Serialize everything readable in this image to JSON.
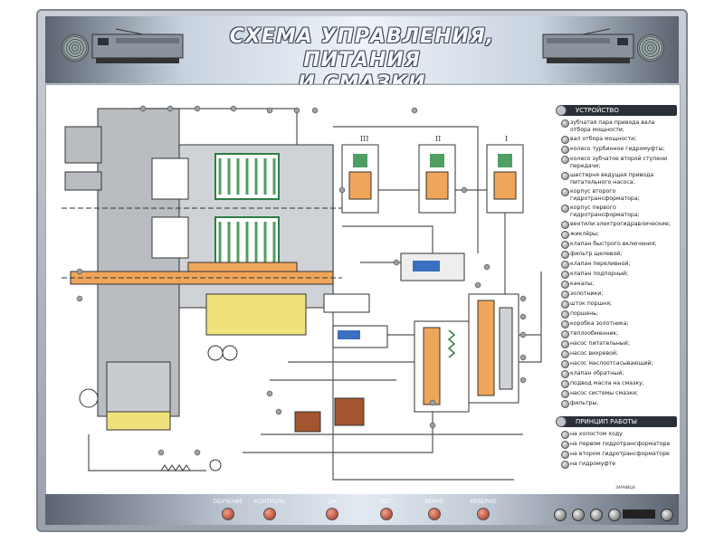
{
  "header": {
    "title_line1": "СХЕМА УПРАВЛЕНИЯ, ПИТАНИЯ",
    "title_line2": "И СМАЗКИ ГИДРОПЕРЕДАЧИ"
  },
  "diagram": {
    "valve_labels": [
      "III",
      "II",
      "I"
    ]
  },
  "legend": {
    "device_title": "УСТРОЙСТВО",
    "device_items": [
      "зубчатая пара привода вала отбора мощности;",
      "вал отбора мощности;",
      "колесо турбинное гидромуфты;",
      "колесо зубчатое второй ступени передачи;",
      "шестерня ведущая привода питательного насоса;",
      "корпус второго гидротрансформатора;",
      "корпус первого гидротрансформатора;",
      "вентили электрогидравлические;",
      "жиклёры;",
      "клапан быстрого включения;",
      "фильтр щелевой;",
      "клапан переливной;",
      "клапан подпорный;",
      "каналы;",
      "золотники;",
      "шток поршня;",
      "поршень;",
      "коробка золотника;",
      "теплообменник;",
      "насос питательный;",
      "насос вихревой;",
      "насос маслоотсасывающий;",
      "клапан обратный;",
      "подвод масла на смазку;",
      "насос системы смазки;",
      "фильтры."
    ],
    "principle_title": "ПРИНЦИП РАБОТЫ",
    "principle_items": [
      "на холостом ходу",
      "на первом гидротрансформаторе",
      "на втором гидротрансформаторе",
      "на гидромуфте"
    ]
  },
  "footer": {
    "buttons": [
      "ОБУЧЕНИЕ",
      "КОНТРОЛЬ",
      "ДА",
      "НЕТ",
      "ВЕРНО",
      "НЕВЕРНО"
    ],
    "brand": "ЗАРНИЦА"
  },
  "colors": {
    "gray_metal": "#b9bcc0",
    "orange_oil": "#f0a65a",
    "green_turbine": "#4f9e62",
    "yellow_sump": "#efe27a",
    "brown_block": "#a2552e",
    "blue_spring": "#3b6fc0"
  }
}
